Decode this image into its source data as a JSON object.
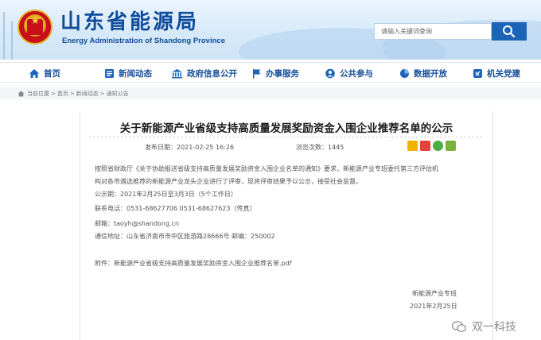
{
  "header": {
    "title": "山东省能源局",
    "subtitle": "Energy Administration of Shandong Province",
    "search_placeholder": "请输入关键词查询"
  },
  "nav": {
    "items": [
      {
        "label": "首页",
        "icon": "home-icon"
      },
      {
        "label": "新闻动态",
        "icon": "news-icon"
      },
      {
        "label": "政府信息公开",
        "icon": "government-building-icon"
      },
      {
        "label": "办事服务",
        "icon": "flag-icon"
      },
      {
        "label": "公共参与",
        "icon": "people-icon"
      },
      {
        "label": "数据开放",
        "icon": "data-pie-icon"
      },
      {
        "label": "机关党建",
        "icon": "party-icon"
      }
    ]
  },
  "breadcrumb": {
    "prefix": "当前位置",
    "items": [
      "首页",
      "新闻动态",
      "通知公告"
    ]
  },
  "article": {
    "title": "关于新能源产业省级支持高质量发展奖励资金入围企业推荐名单的公示",
    "publish_label": "发布日期：",
    "publish_date": "2021-02-25 16:26",
    "views_label": "浏览次数：",
    "views": "1445",
    "paragraph_line1": "按照省财政厅《关于协助报送省级支持高质量发展奖励资金入围企业名单的通知》要求，新能源产业专班委托第三方评估机",
    "paragraph_line2": "构对各市遴选推荐的新能源产业龙头企业进行了评审，现将评审结果予以公示，接受社会监督。",
    "period": "公示期：2021年2月25日至3月3日（5个工作日）",
    "phone": "联系电话：0531-68627706    0531-68627623（传真）",
    "email": "邮箱：taoyh@shandong.cn",
    "address": "通信地址：山东省济南市市中区旅游路28666号      邮编：250002",
    "attachment": "附件：新能源产业省级支持高质量发展奖励资金入围企业推荐名单.pdf",
    "signoff_org": "新能源产业专班",
    "signoff_date": "2021年2月25日"
  },
  "share_icons": [
    "favorite-icon",
    "weibo-icon",
    "wechat-icon",
    "qq-icon"
  ],
  "watermark": "双一科技",
  "colors": {
    "brand_blue": "#0f4c9c",
    "nav_blue": "#164f9a",
    "emblem_red": "#c8101a"
  }
}
